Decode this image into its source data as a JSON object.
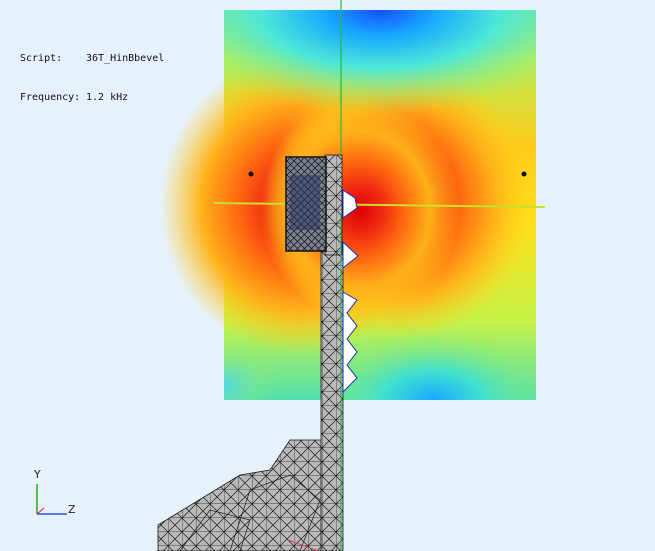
{
  "info": {
    "script_label": "Script:",
    "script_value": "36T_HinBbevel",
    "frequency_label": "Frequency:",
    "frequency_value": "1.2 kHz"
  },
  "axes": {
    "y_label": "Y",
    "z_label": "Z",
    "y_color": "#22aa22",
    "z_color": "#2255dd"
  },
  "colors": {
    "background": "#e6f1fb",
    "mesh_fill": "#b9b9b9",
    "mesh_stroke": "#1a1a1a",
    "heat_low": "#1a7cff",
    "heat_high": "#e80d0d"
  }
}
